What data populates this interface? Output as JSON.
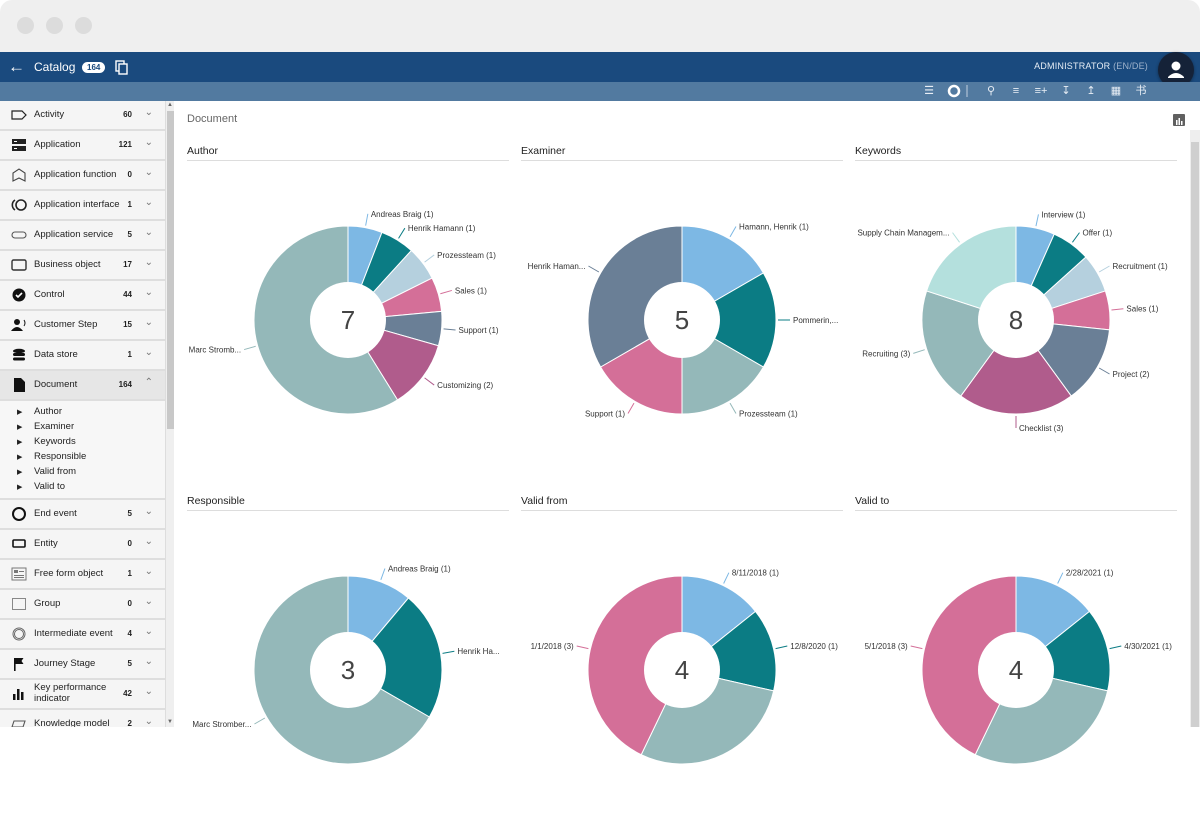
{
  "window": {
    "controls": [
      "close",
      "minimize",
      "maximize"
    ]
  },
  "header": {
    "back_icon": "arrow-left-icon",
    "title": "Catalog",
    "badge": "164",
    "copy_icon": "copy-icon",
    "user_label": "ADMINISTRATOR",
    "user_lang": "(EN/DE)",
    "avatar_icon": "person-icon"
  },
  "toolbar": {
    "icons": [
      "list-icon",
      "donut-chart-icon",
      "search-icon",
      "checklist-icon",
      "add-list-icon",
      "download-icon",
      "upload-icon",
      "delete-filter-icon",
      "translate-icon"
    ]
  },
  "sidebar": {
    "items": [
      {
        "label": "Activity",
        "count": "60",
        "icon": "activity-icon"
      },
      {
        "label": "Application",
        "count": "121",
        "icon": "application-icon"
      },
      {
        "label": "Application function",
        "count": "0",
        "icon": "application-function-icon"
      },
      {
        "label": "Application interface",
        "count": "1",
        "icon": "application-interface-icon"
      },
      {
        "label": "Application service",
        "count": "5",
        "icon": "application-service-icon"
      },
      {
        "label": "Business object",
        "count": "17",
        "icon": "business-object-icon"
      },
      {
        "label": "Control",
        "count": "44",
        "icon": "check-circle-icon"
      },
      {
        "label": "Customer Step",
        "count": "15",
        "icon": "customer-step-icon"
      },
      {
        "label": "Data store",
        "count": "1",
        "icon": "database-icon"
      },
      {
        "label": "Document",
        "count": "164",
        "icon": "document-icon",
        "expanded": true,
        "children": [
          "Author",
          "Examiner",
          "Keywords",
          "Responsible",
          "Valid from",
          "Valid to"
        ]
      },
      {
        "label": "End event",
        "count": "5",
        "icon": "end-event-icon"
      },
      {
        "label": "Entity",
        "count": "0",
        "icon": "entity-icon"
      },
      {
        "label": "Free form object",
        "count": "1",
        "icon": "free-form-icon"
      },
      {
        "label": "Group",
        "count": "0",
        "icon": "group-icon"
      },
      {
        "label": "Intermediate event",
        "count": "4",
        "icon": "intermediate-event-icon"
      },
      {
        "label": "Journey Stage",
        "count": "5",
        "icon": "flag-icon"
      },
      {
        "label": "Key performance indicator",
        "count": "42",
        "icon": "bar-chart-icon"
      },
      {
        "label": "Knowledge model",
        "count": "2",
        "icon": "knowledge-model-icon"
      }
    ]
  },
  "main": {
    "title": "Document",
    "chart_toggle_icon": "bar-chart-icon"
  },
  "colors": {
    "header": "#1a4a7e",
    "toolbar": "#527aa0",
    "light_blue": "#7db8e4",
    "teal": "#0b7c84",
    "pale_blue": "#b5d0de",
    "pink": "#d46f98",
    "slate": "#6a7f96",
    "magenta": "#b05c8c",
    "grey_teal": "#94b8b9",
    "mint": "#b4e0dd"
  },
  "chart_data": [
    {
      "type": "pie",
      "title": "Author",
      "center_value": "7",
      "categories": [
        "Andreas Braig (1)",
        "Henrik Hamann (1)",
        "Prozessteam (1)",
        "Sales (1)",
        "Support (1)",
        "Customizing (2)",
        "Marc Stromb..."
      ],
      "values": [
        1,
        1,
        1,
        1,
        1,
        2,
        10
      ],
      "colors": [
        "#7db8e4",
        "#0b7c84",
        "#b5d0de",
        "#d46f98",
        "#6a7f96",
        "#b05c8c",
        "#94b8b9"
      ]
    },
    {
      "type": "pie",
      "title": "Examiner",
      "center_value": "5",
      "categories": [
        "Hamann, Henrik (1)",
        "Pommerin,...",
        "Prozessteam (1)",
        "Support (1)",
        "Henrik Haman..."
      ],
      "values": [
        1,
        1,
        1,
        1,
        2
      ],
      "colors": [
        "#7db8e4",
        "#0b7c84",
        "#94b8b9",
        "#d46f98",
        "#6a7f96"
      ]
    },
    {
      "type": "pie",
      "title": "Keywords",
      "center_value": "8",
      "categories": [
        "Interview (1)",
        "Offer (1)",
        "Recruitment (1)",
        "Sales (1)",
        "Project (2)",
        "Checklist (3)",
        "Recruiting (3)",
        "Supply Chain Managem..."
      ],
      "values": [
        1,
        1,
        1,
        1,
        2,
        3,
        3,
        3
      ],
      "colors": [
        "#7db8e4",
        "#0b7c84",
        "#b5d0de",
        "#d46f98",
        "#6a7f96",
        "#b05c8c",
        "#94b8b9",
        "#b4e0dd"
      ]
    },
    {
      "type": "pie",
      "title": "Responsible",
      "center_value": "3",
      "categories": [
        "Andreas Braig (1)",
        "Henrik Ha...",
        "Marc Stromber..."
      ],
      "values": [
        1,
        2,
        6
      ],
      "colors": [
        "#7db8e4",
        "#0b7c84",
        "#94b8b9"
      ]
    },
    {
      "type": "pie",
      "title": "Valid from",
      "center_value": "4",
      "categories": [
        "8/11/2018 (1)",
        "12/8/2020 (1)",
        "",
        "1/1/2018 (3)"
      ],
      "values": [
        1,
        1,
        2,
        3
      ],
      "colors": [
        "#7db8e4",
        "#0b7c84",
        "#94b8b9",
        "#d46f98"
      ]
    },
    {
      "type": "pie",
      "title": "Valid to",
      "center_value": "4",
      "categories": [
        "2/28/2021 (1)",
        "4/30/2021 (1)",
        "",
        "5/1/2018 (3)"
      ],
      "values": [
        1,
        1,
        2,
        3
      ],
      "colors": [
        "#7db8e4",
        "#0b7c84",
        "#94b8b9",
        "#d46f98"
      ]
    }
  ]
}
